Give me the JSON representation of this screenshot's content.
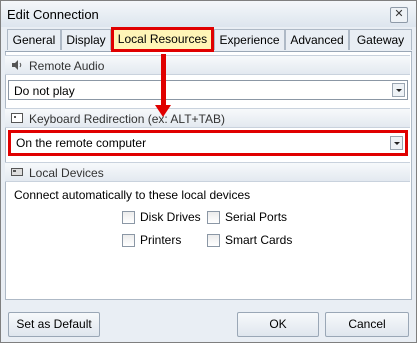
{
  "window": {
    "title": "Edit Connection",
    "close_glyph": "✕"
  },
  "tabs": [
    {
      "label": "General",
      "selected": false
    },
    {
      "label": "Display",
      "selected": false
    },
    {
      "label": "Local Resources",
      "selected": true
    },
    {
      "label": "Experience",
      "selected": false
    },
    {
      "label": "Advanced",
      "selected": false
    },
    {
      "label": "Gateway",
      "selected": false
    }
  ],
  "remote_audio": {
    "header": "Remote Audio",
    "icon": "speaker-icon",
    "value": "Do not play"
  },
  "keyboard": {
    "header": "Keyboard Redirection (ex: ALT+TAB)",
    "icon": "keyboard-icon",
    "value": "On the remote computer"
  },
  "local_devices": {
    "header": "Local Devices",
    "icon": "devices-icon",
    "intro": "Connect automatically to these local devices",
    "options": [
      {
        "label": "Disk Drives",
        "checked": false
      },
      {
        "label": "Serial Ports",
        "checked": false
      },
      {
        "label": "Printers",
        "checked": false
      },
      {
        "label": "Smart Cards",
        "checked": false
      }
    ]
  },
  "footer": {
    "default_label": "Set as Default",
    "ok_label": "OK",
    "cancel_label": "Cancel"
  },
  "colors": {
    "highlight": "#e00000",
    "selected_tab_bg": "#fff5b7"
  }
}
